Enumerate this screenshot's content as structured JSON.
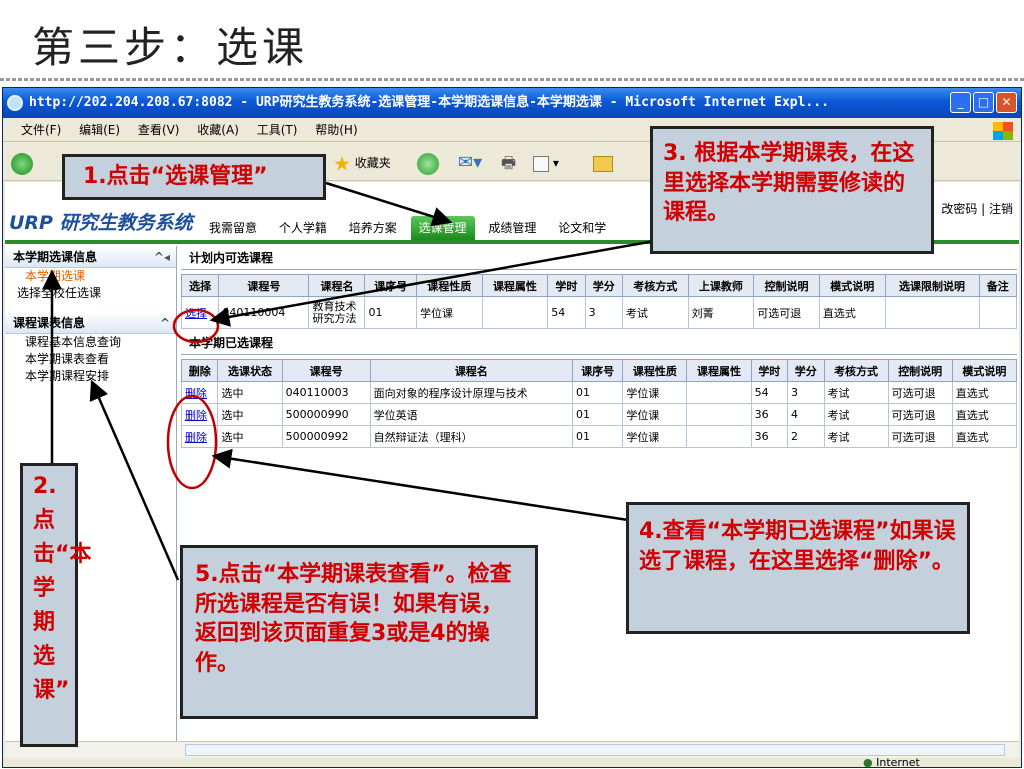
{
  "slide_title": "第三步：选课",
  "window": {
    "title": "http://202.204.208.67:8082 - URP研究生教务系统-选课管理-本学期选课信息-本学期选课 - Microsoft Internet Expl...",
    "menu": [
      "文件(F)",
      "编辑(E)",
      "查看(V)",
      "收藏(A)",
      "工具(T)",
      "帮助(H)"
    ],
    "toolbar": {
      "back": "后退",
      "favorites": "收藏夹"
    }
  },
  "system": {
    "logo_brand": "URP",
    "logo_text": "研究生教务系统",
    "user_links": "改密码 | 注销",
    "nav": [
      "我需留意",
      "个人学籍",
      "培养方案",
      "选课管理",
      "成绩管理",
      "论文和学"
    ]
  },
  "sidebar": {
    "section1_title": "本学期选课信息",
    "section1_items": [
      "本学期选课",
      "选择全校任选课"
    ],
    "section2_title": "课程课表信息",
    "section2_items": [
      "课程基本信息查询",
      "本学期课表查看",
      "本学期课程安排"
    ]
  },
  "plan_table": {
    "title": "计划内可选课程",
    "headers": [
      "选择",
      "课程号",
      "课程名",
      "课序号",
      "课程性质",
      "课程属性",
      "学时",
      "学分",
      "考核方式",
      "上课教师",
      "控制说明",
      "模式说明",
      "选课限制说明",
      "备注"
    ],
    "row": [
      "选择",
      "040110004",
      "教育技术研究方法",
      "01",
      "学位课",
      "",
      "54",
      "3",
      "考试",
      "刘菁",
      "可选可退",
      "直选式",
      "",
      ""
    ]
  },
  "selected_table": {
    "title": "本学期已选课程",
    "headers": [
      "删除",
      "选课状态",
      "课程号",
      "课程名",
      "课序号",
      "课程性质",
      "课程属性",
      "学时",
      "学分",
      "考核方式",
      "控制说明",
      "模式说明"
    ],
    "rows": [
      [
        "删除",
        "选中",
        "040110003",
        "面向对象的程序设计原理与技术",
        "01",
        "学位课",
        "",
        "54",
        "3",
        "考试",
        "可选可退",
        "直选式"
      ],
      [
        "删除",
        "选中",
        "500000990",
        "学位英语",
        "01",
        "学位课",
        "",
        "36",
        "4",
        "考试",
        "可选可退",
        "直选式"
      ],
      [
        "删除",
        "选中",
        "500000992",
        "自然辩证法（理科）",
        "01",
        "学位课",
        "",
        "36",
        "2",
        "考试",
        "可选可退",
        "直选式"
      ]
    ]
  },
  "status_text": "Internet",
  "callouts": {
    "c1": "1.点击“选课管理”",
    "c2": "2.点击“本学期选课”",
    "c3": "3. 根据本学期课表，在这里选择本学期需要修读的课程。",
    "c4": "4.查看“本学期已选课程”如果误选了课程，在这里选择“删除”。",
    "c5": "5.点击“本学期课表查看”。检查所选课程是否有误！如果有误，返回到该页面重复3或是4的操作。"
  },
  "colors": {
    "callout_text": "#d00000",
    "callout_bg": "#c4d0dc",
    "nav_active": "#2b8c2b",
    "link": "#0000cc"
  }
}
